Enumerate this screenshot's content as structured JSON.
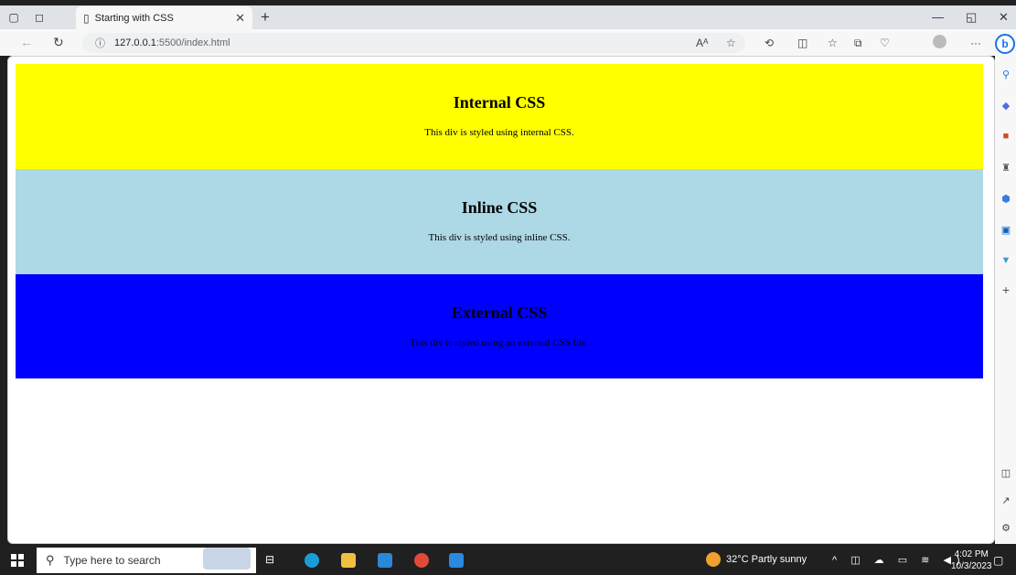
{
  "browser": {
    "tab_title": "Starting with CSS",
    "url_host": "127.0.0.1",
    "url_path": ":5500/index.html"
  },
  "page": {
    "blocks": [
      {
        "heading": "Internal CSS",
        "text": "This div is styled using internal CSS.",
        "bg": "#ffff00"
      },
      {
        "heading": "Inline CSS",
        "text": "This div is styled using inline CSS.",
        "bg": "#add8e6"
      },
      {
        "heading": "External CSS",
        "text": "This div is styled using an external CSS file.",
        "bg": "#0000ff"
      }
    ]
  },
  "taskbar": {
    "search_placeholder": "Type here to search",
    "weather": "32°C  Partly sunny",
    "time": "4:02 PM",
    "date": "10/3/2023"
  },
  "colors": {
    "accent": "#1a73e8",
    "taskbar_bg": "#202020"
  }
}
